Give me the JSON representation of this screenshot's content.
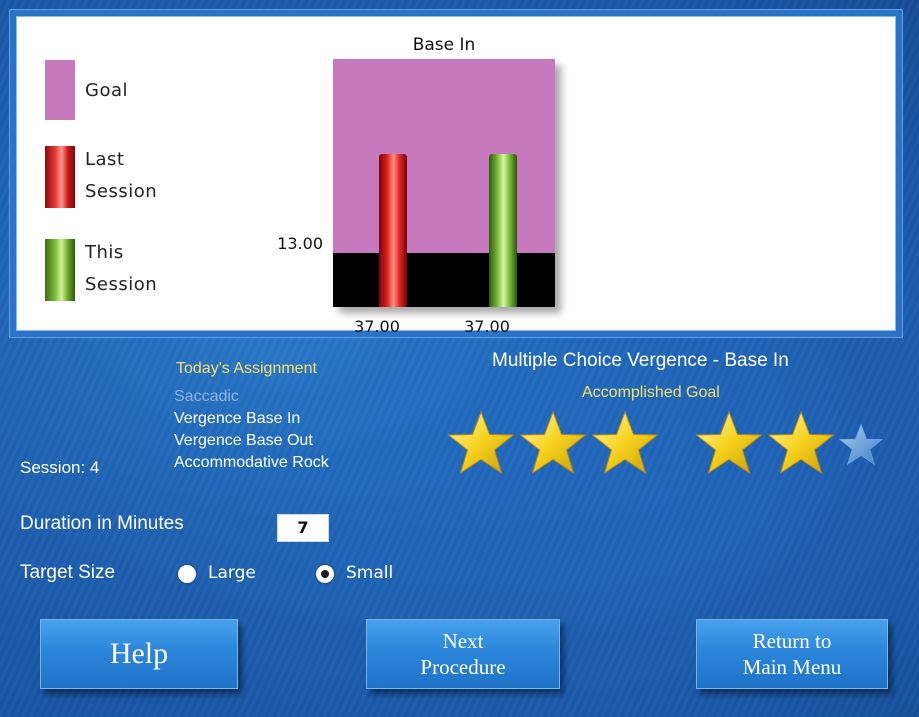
{
  "chart_data": {
    "type": "bar",
    "title": "Base In",
    "categories": [
      "Last Session",
      "This Session"
    ],
    "values": [
      37.0,
      37.0
    ],
    "value_labels": [
      "37.00",
      "37.00"
    ],
    "goal_line_label": "13.00",
    "legend": [
      "Goal",
      "Last Session",
      "This Session"
    ],
    "colors": {
      "goal": "#c779bd",
      "last_session": "#d81e1e",
      "this_session": "#7bc13a",
      "below_goal": "#000000"
    }
  },
  "legend": {
    "goal": "Goal",
    "last_session": "Last\nSession",
    "this_session": "This\nSession"
  },
  "assignment": {
    "title": "Today's Assignment",
    "items": [
      {
        "label": "Saccadic",
        "dim": true
      },
      {
        "label": "Vergence Base In",
        "dim": false
      },
      {
        "label": "Vergence Base Out",
        "dim": false
      },
      {
        "label": "Accommodative Rock",
        "dim": false
      }
    ]
  },
  "session_label": "Session: 4",
  "procedure": {
    "title": "Multiple Choice Vergence - Base In",
    "accomplished_label": "Accomplished Goal",
    "stars_earned": 5,
    "stars_total": 6
  },
  "settings": {
    "duration_label": "Duration in Minutes",
    "duration_value": "7",
    "target_size_label": "Target Size",
    "target_options": [
      "Large",
      "Small"
    ],
    "target_selected": "Small"
  },
  "buttons": {
    "help": "Help",
    "next_line1": "Next",
    "next_line2": "Procedure",
    "return_line1": "Return to",
    "return_line2": "Main Menu"
  }
}
